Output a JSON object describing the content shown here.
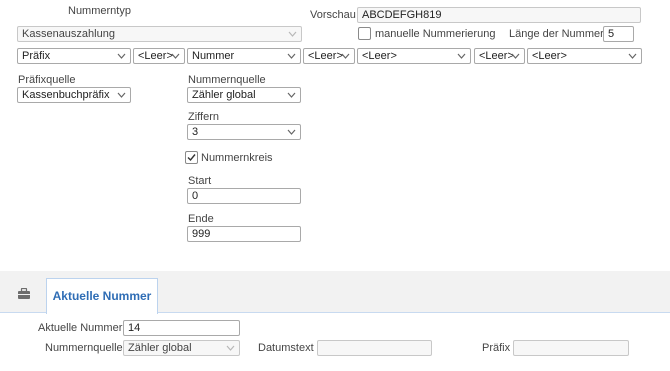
{
  "header": {
    "nummerntyp_label": "Nummerntyp",
    "vorschau_label": "Vorschau",
    "vorschau_value": "ABCDEFGH819"
  },
  "type_select": {
    "value": "Kassenauszahlung"
  },
  "manuelle_nummerierung": {
    "label": "manuelle Nummerierung",
    "checked": false
  },
  "laenge": {
    "label": "Länge der Nummer",
    "value": "5"
  },
  "segments": [
    "Präfix",
    "<Leer>",
    "Nummer",
    "<Leer>",
    "<Leer>",
    "<Leer>",
    "<Leer>"
  ],
  "praefixquelle": {
    "label": "Präfixquelle",
    "value": "Kassenbuchpräfix"
  },
  "nummernquelle": {
    "label": "Nummernquelle",
    "value": "Zähler global"
  },
  "ziffern": {
    "label": "Ziffern",
    "value": "3"
  },
  "nummernkreis": {
    "label": "Nummernkreis",
    "checked": true
  },
  "start": {
    "label": "Start",
    "value": "0"
  },
  "ende": {
    "label": "Ende",
    "value": "999"
  },
  "tabs": [
    {
      "label": "Aktuelle Nummer",
      "icon": "toolbox-icon"
    }
  ],
  "aktuell": {
    "aktuelle_nummer_label": "Aktuelle Nummer",
    "aktuelle_nummer_value": "14",
    "nummernquelle_label": "Nummernquelle",
    "nummernquelle_value": "Zähler global",
    "datumstext_label": "Datumstext",
    "datumstext_value": "",
    "praefix_label": "Präfix",
    "praefix_value": ""
  },
  "colors": {
    "accent": "#2f6db5",
    "tab_border": "#bcd3ee",
    "border": "#a9a9a9"
  }
}
